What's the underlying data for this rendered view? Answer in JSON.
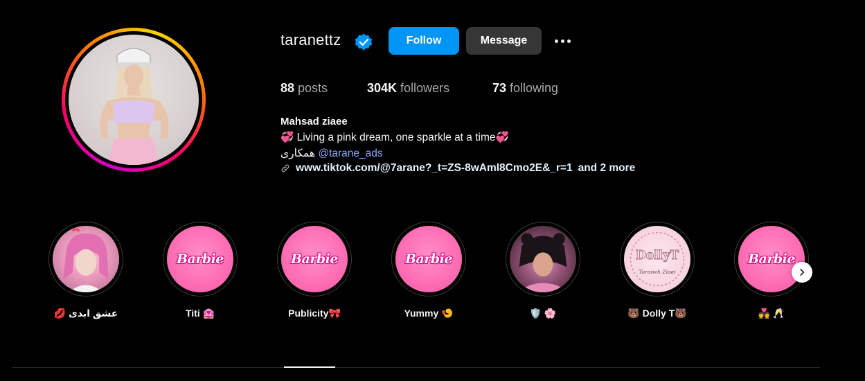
{
  "profile": {
    "username": "taranettz",
    "verified": true,
    "follow_label": "Follow",
    "message_label": "Message",
    "more_icon": "more-dots-icon"
  },
  "stats": {
    "posts_count": "88",
    "posts_label": "posts",
    "followers_count": "304K",
    "followers_label": "followers",
    "following_count": "73",
    "following_label": "following"
  },
  "bio": {
    "full_name": "Mahsad ziaee",
    "line1": "💞 Living a pink dream, one sparkle at a time💞",
    "line2_text": "همکاری",
    "line2_mention": "@tarane_ads",
    "link_text": "www.tiktok.com/@7arane?_t=ZS-8wAmI8Cmo2E&_r=1",
    "link_more": "and 2 more"
  },
  "highlights": [
    {
      "label": "💋 عشق ابدی",
      "image": "photo-pink-hair"
    },
    {
      "label": "Titi 🏩",
      "image": "barbie-logo"
    },
    {
      "label": "Publicity🎀",
      "image": "barbie-logo"
    },
    {
      "label": "Yummy 🍤",
      "image": "barbie-logo"
    },
    {
      "label": "🛡️ 🌸",
      "image": "photo-black-bear-hat"
    },
    {
      "label": "🐻 Dolly T🐻",
      "image": "dolly-t-logo"
    },
    {
      "label": "💑 🥂",
      "image": "barbie-logo"
    }
  ],
  "barbie_text": "Barbie",
  "dolly_logo": {
    "title": "DollyT",
    "subtitle": "Taraneh Ziaei"
  },
  "colors": {
    "follow_button": "#0095f6",
    "message_button": "#363636",
    "verified_badge": "#0095f6",
    "barbie_pink": "#ff6fb5",
    "background": "#000000"
  }
}
